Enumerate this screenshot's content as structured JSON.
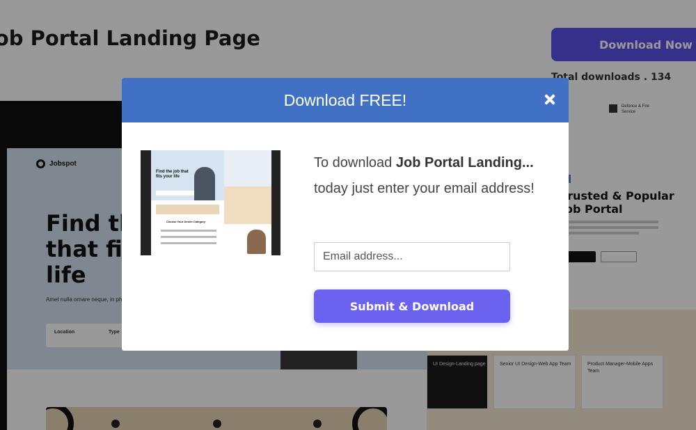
{
  "page": {
    "title": "Job Portal Landing Page",
    "download_button": "Download Now",
    "total_downloads": "Total downloads . 134"
  },
  "preview": {
    "brand": "Jobspot",
    "headline": "Find the job that fits your life",
    "subtext": "Amet nulla ornare neque, in phasellus mattis. Eget eget",
    "search_location": "Location",
    "search_type": "Type",
    "category": "Defence & Fire Service",
    "trusted_heading": "Trusted & Popular Job Portal",
    "job_cards": [
      "UI Design-Landing page",
      "Senior UI Design-Web App Team",
      "Product Manager-Mobile Apps Team"
    ]
  },
  "modal": {
    "title": "Download FREE!",
    "text_prefix": "To download ",
    "text_bold": "Job Portal Landing...",
    "text_suffix": " today just enter your email address!",
    "email_placeholder": "Email address...",
    "submit_label": "Submit & Download"
  },
  "thumbnail": {
    "headline": "Find the job that fits your life",
    "category_title": "Choose Your Desire Category"
  },
  "colors": {
    "modal_header": "#4171c4",
    "submit_button": "#6b63f0",
    "download_button": "#5b50e8"
  }
}
